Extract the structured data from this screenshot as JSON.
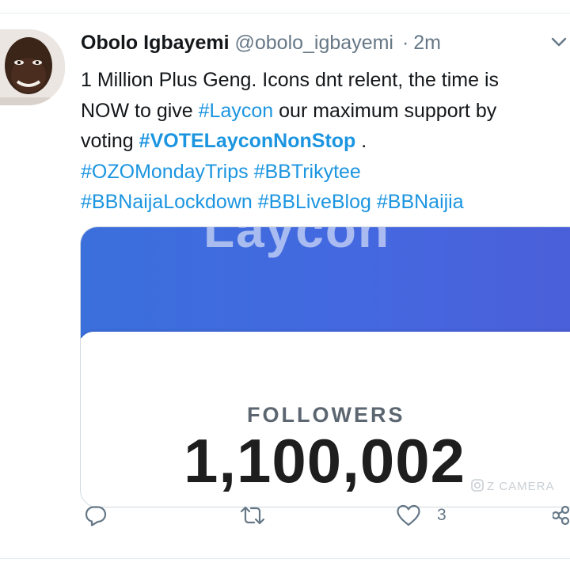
{
  "tweet": {
    "author_name": "Obolo Igbayemi",
    "author_handle": "@obolo_igbayemi",
    "separator": "·",
    "time": "2m",
    "text_line1": "1 Million Plus Geng. Icons dnt relent, the time is",
    "text_line2_pre": "NOW to give ",
    "hashtag_laycon": "#Laycon",
    "text_line2_post": " our maximum support by",
    "text_line3_pre": "voting ",
    "hashtag_vote": "#VOTELayconNonStop",
    "text_line3_post": " .",
    "hashtag_ozo": "#OZOMondayTrips",
    "hashtag_trikytee": "#BBTrikytee",
    "hashtag_lockdown": "#BBNaijaLockdown",
    "hashtag_liveblog": "#BBLiveBlog",
    "hashtag_naijia": "#BBNaijia"
  },
  "media": {
    "banner_partial_text": "Laycon",
    "followers_label": "FOLLOWERS",
    "followers_count": "1,100,002",
    "watermark": "Z CAMERA"
  },
  "actions": {
    "like_count": "3"
  },
  "icons": {
    "caret": "chevron-down-icon",
    "reply": "reply-icon",
    "retweet": "retweet-icon",
    "like": "heart-icon",
    "share": "share-icon"
  },
  "colors": {
    "link": "#1b95e0",
    "muted": "#657786",
    "banner_blue": "#4468e0"
  }
}
